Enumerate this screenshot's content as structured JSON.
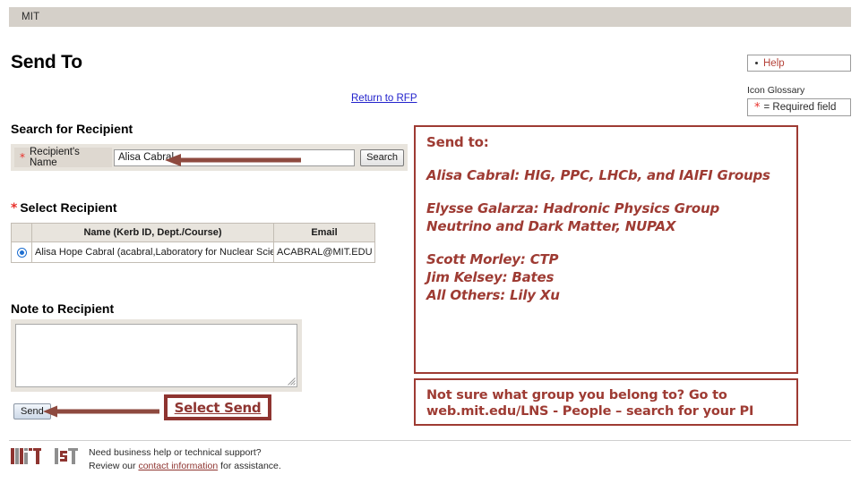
{
  "topbar": {
    "brand": "MIT"
  },
  "page": {
    "title": "Send To"
  },
  "help": {
    "label": "Help"
  },
  "glossary": {
    "caption": "Icon Glossary",
    "required_text": "= Required field"
  },
  "links": {
    "return_to_rfp": "Return to RFP"
  },
  "search_section": {
    "heading": "Search for Recipient",
    "field_label": "Recipient's Name",
    "input_value": "Alisa Cabral",
    "input_placeholder": "",
    "search_button": "Search"
  },
  "select_section": {
    "heading": "Select Recipient",
    "columns": [
      "",
      "Name (Kerb ID, Dept./Course)",
      "Email"
    ],
    "rows": [
      {
        "selected": true,
        "name": "Alisa Hope Cabral (acabral,Laboratory for Nuclear Science)",
        "email": "ACABRAL@MIT.EDU"
      }
    ]
  },
  "note_section": {
    "heading": "Note to Recipient",
    "textarea_value": "",
    "textarea_placeholder": ""
  },
  "actions": {
    "send_button": "Send"
  },
  "annotations": {
    "select_send": "Select Send",
    "sendto_box": {
      "heading": "Send to:",
      "lines": [
        "Alisa Cabral: HIG, PPC, LHCb, and IAIFI Groups",
        "Elysse Galarza: Hadronic Physics Group",
        "Neutrino and Dark Matter, NUPAX",
        "Scott Morley: CTP",
        "Jim Kelsey: Bates",
        "All Others: Lily Xu"
      ]
    },
    "note_box": {
      "line1": "Not sure what group you belong to?  Go to",
      "line2": "web.mit.edu/LNS - People – search for your PI"
    }
  },
  "footer": {
    "logo_mit": "MIT",
    "logo_ist": "IST",
    "line1": "Need business help or technical support?",
    "line2_prefix": "Review our ",
    "line2_link": "contact information",
    "line2_suffix": " for assistance."
  },
  "colors": {
    "topbar_bg": "#d5d0c9",
    "panel_bg": "#e8e4dd",
    "annotation_maroon": "#9e3b33",
    "arrow_maroon": "#8e4a3f",
    "link_blue": "#2222cc",
    "required_red": "#e8302a",
    "help_red": "#b5433a"
  }
}
